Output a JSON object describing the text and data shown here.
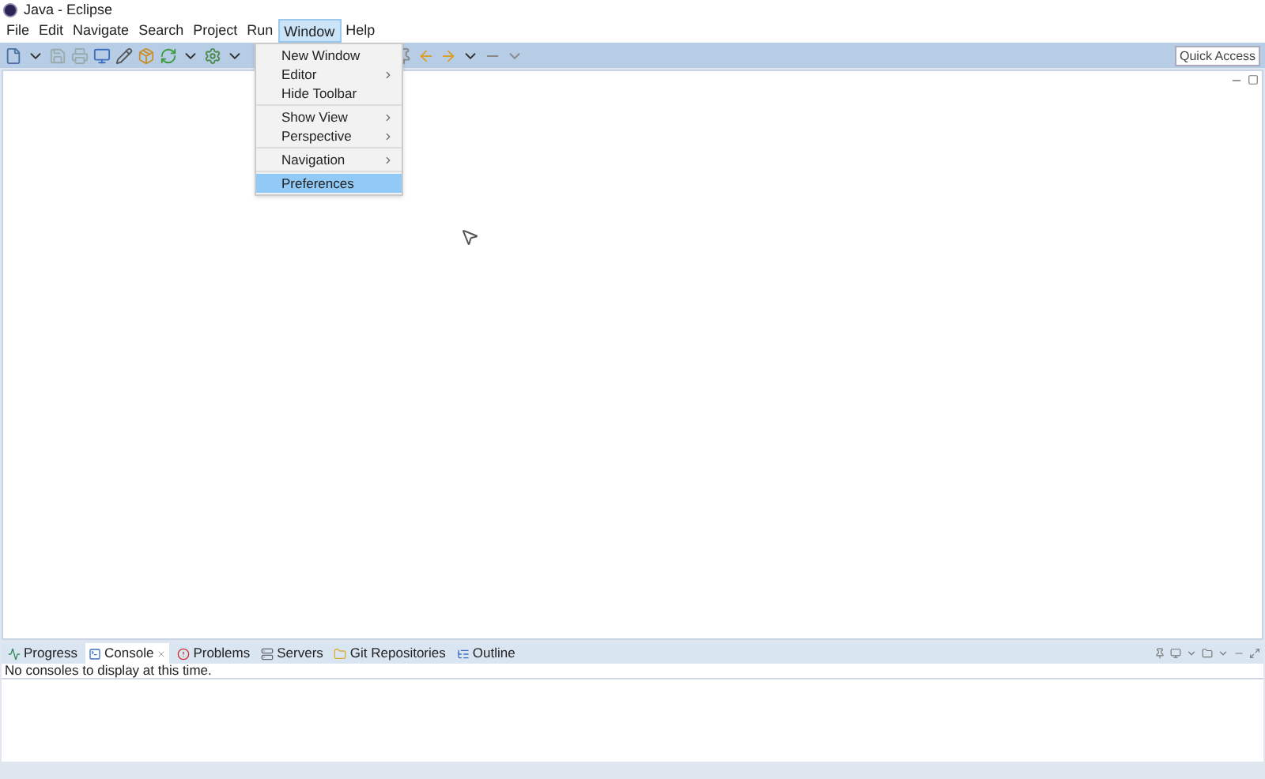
{
  "window": {
    "title": "Java - Eclipse"
  },
  "menubar": [
    {
      "label": "File",
      "selected": false
    },
    {
      "label": "Edit",
      "selected": false
    },
    {
      "label": "Navigate",
      "selected": false
    },
    {
      "label": "Search",
      "selected": false
    },
    {
      "label": "Project",
      "selected": false
    },
    {
      "label": "Run",
      "selected": false
    },
    {
      "label": "Window",
      "selected": true
    },
    {
      "label": "Help",
      "selected": false
    }
  ],
  "dropdown": {
    "groups": [
      [
        {
          "label": "New Window",
          "submenu": false,
          "selected": false
        },
        {
          "label": "Editor",
          "submenu": true,
          "selected": false
        },
        {
          "label": "Hide Toolbar",
          "submenu": false,
          "selected": false
        }
      ],
      [
        {
          "label": "Show View",
          "submenu": true,
          "selected": false
        },
        {
          "label": "Perspective",
          "submenu": true,
          "selected": false
        }
      ],
      [
        {
          "label": "Navigation",
          "submenu": true,
          "selected": false
        }
      ],
      [
        {
          "label": "Preferences",
          "submenu": false,
          "selected": true
        }
      ]
    ]
  },
  "quick_access": {
    "placeholder": "Quick Access"
  },
  "bottom_panel": {
    "tabs": [
      {
        "label": "Progress",
        "selected": false
      },
      {
        "label": "Console",
        "selected": true
      },
      {
        "label": "Problems",
        "selected": false
      },
      {
        "label": "Servers",
        "selected": false
      },
      {
        "label": "Git Repositories",
        "selected": false
      },
      {
        "label": "Outline",
        "selected": false
      }
    ],
    "message": "No consoles to display at this time."
  }
}
